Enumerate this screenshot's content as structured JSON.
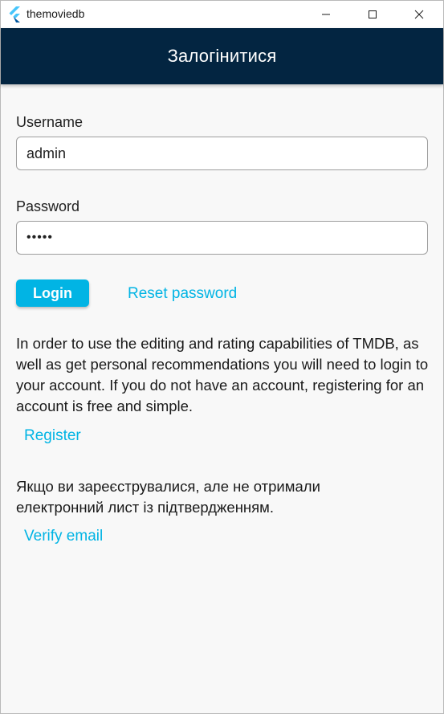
{
  "window": {
    "title": "themoviedb"
  },
  "appbar": {
    "title": "Залогінитися"
  },
  "form": {
    "username_label": "Username",
    "username_value": "admin",
    "password_label": "Password",
    "password_value": "•••••"
  },
  "actions": {
    "login_label": "Login",
    "reset_label": "Reset password"
  },
  "info": {
    "text": "In order to use the editing and rating capabilities of TMDB, as well as get personal recommendations you will need to login to your account. If you do not have an account, registering for an account is free and simple.",
    "register_label": "Register",
    "verify_text": "Якщо ви зареєструвалися, але не отримали електронний лист із підтвердженням.",
    "verify_label": "Verify email"
  },
  "colors": {
    "appbar_bg": "#032541",
    "accent": "#01b4e4",
    "background": "#f8f8f8"
  }
}
